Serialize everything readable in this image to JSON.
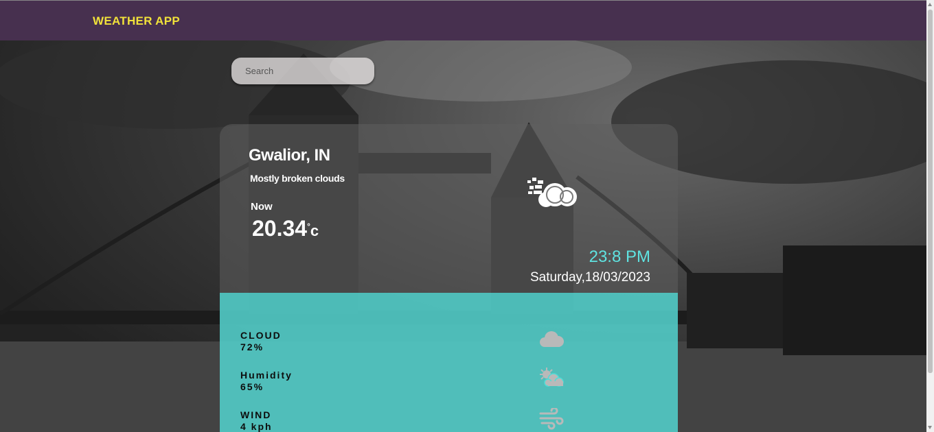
{
  "navbar": {
    "brand": "WEATHER APP"
  },
  "search": {
    "placeholder": "Search"
  },
  "weather": {
    "location": "Gwalior, IN",
    "description": "Mostly broken clouds",
    "now_label": "Now",
    "temperature": "20.34",
    "unit_degree": "°",
    "unit_letter": "c",
    "icon": "cloud-wind-icon",
    "time": "23:8 PM",
    "date": "Saturday,18/03/2023"
  },
  "stats": [
    {
      "label": "CLOUD",
      "value": "72%",
      "icon": "cloud-icon"
    },
    {
      "label": "Humidity",
      "value": "65%",
      "icon": "sun-cloud-icon"
    },
    {
      "label": "WIND",
      "value": "4 kph",
      "icon": "wind-icon"
    }
  ],
  "colors": {
    "navbar": "#47304f",
    "brand": "#f1e23a",
    "accent_time": "#5fe3e1",
    "stats_panel": "#50dcd7"
  }
}
